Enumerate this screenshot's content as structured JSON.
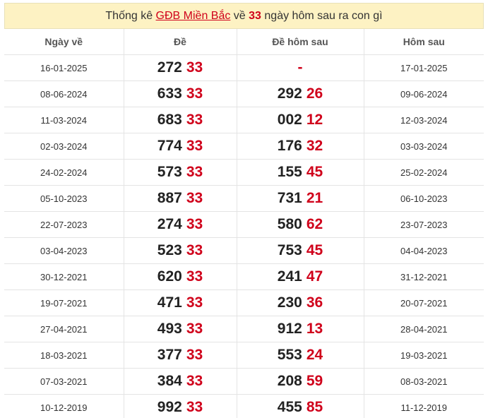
{
  "title": {
    "prefix": "Thống kê ",
    "link": "GĐB Miền Bắc",
    "middle": " về ",
    "number": "33",
    "suffix": " ngày hôm sau ra con gì"
  },
  "headers": {
    "col1": "Ngày về",
    "col2": "Đề",
    "col3": "Đề hôm sau",
    "col4": "Hôm sau"
  },
  "rows": [
    {
      "date": "16-01-2025",
      "de_pre": "272",
      "de_suf": "33",
      "next_pre": "",
      "next_suf": "",
      "next_dash": "-",
      "next_date": "17-01-2025"
    },
    {
      "date": "08-06-2024",
      "de_pre": "633",
      "de_suf": "33",
      "next_pre": "292",
      "next_suf": "26",
      "next_dash": "",
      "next_date": "09-06-2024"
    },
    {
      "date": "11-03-2024",
      "de_pre": "683",
      "de_suf": "33",
      "next_pre": "002",
      "next_suf": "12",
      "next_dash": "",
      "next_date": "12-03-2024"
    },
    {
      "date": "02-03-2024",
      "de_pre": "774",
      "de_suf": "33",
      "next_pre": "176",
      "next_suf": "32",
      "next_dash": "",
      "next_date": "03-03-2024"
    },
    {
      "date": "24-02-2024",
      "de_pre": "573",
      "de_suf": "33",
      "next_pre": "155",
      "next_suf": "45",
      "next_dash": "",
      "next_date": "25-02-2024"
    },
    {
      "date": "05-10-2023",
      "de_pre": "887",
      "de_suf": "33",
      "next_pre": "731",
      "next_suf": "21",
      "next_dash": "",
      "next_date": "06-10-2023"
    },
    {
      "date": "22-07-2023",
      "de_pre": "274",
      "de_suf": "33",
      "next_pre": "580",
      "next_suf": "62",
      "next_dash": "",
      "next_date": "23-07-2023"
    },
    {
      "date": "03-04-2023",
      "de_pre": "523",
      "de_suf": "33",
      "next_pre": "753",
      "next_suf": "45",
      "next_dash": "",
      "next_date": "04-04-2023"
    },
    {
      "date": "30-12-2021",
      "de_pre": "620",
      "de_suf": "33",
      "next_pre": "241",
      "next_suf": "47",
      "next_dash": "",
      "next_date": "31-12-2021"
    },
    {
      "date": "19-07-2021",
      "de_pre": "471",
      "de_suf": "33",
      "next_pre": "230",
      "next_suf": "36",
      "next_dash": "",
      "next_date": "20-07-2021"
    },
    {
      "date": "27-04-2021",
      "de_pre": "493",
      "de_suf": "33",
      "next_pre": "912",
      "next_suf": "13",
      "next_dash": "",
      "next_date": "28-04-2021"
    },
    {
      "date": "18-03-2021",
      "de_pre": "377",
      "de_suf": "33",
      "next_pre": "553",
      "next_suf": "24",
      "next_dash": "",
      "next_date": "19-03-2021"
    },
    {
      "date": "07-03-2021",
      "de_pre": "384",
      "de_suf": "33",
      "next_pre": "208",
      "next_suf": "59",
      "next_dash": "",
      "next_date": "08-03-2021"
    },
    {
      "date": "10-12-2019",
      "de_pre": "992",
      "de_suf": "33",
      "next_pre": "455",
      "next_suf": "85",
      "next_dash": "",
      "next_date": "11-12-2019"
    }
  ]
}
